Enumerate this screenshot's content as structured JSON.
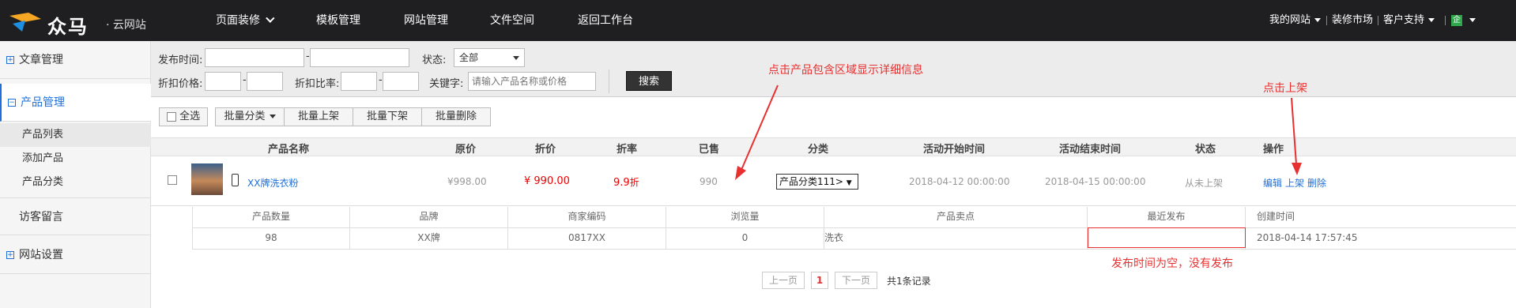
{
  "topbar": {
    "logo_text": "众马",
    "logo_sub": "· 云网站",
    "nav": [
      "页面装修",
      "模板管理",
      "网站管理",
      "文件空间",
      "返回工作台"
    ],
    "right": {
      "my_site": "我的网站",
      "market": "装修市场",
      "support": "客户支持",
      "tenant": "企"
    }
  },
  "sidebar": {
    "article": "文章管理",
    "product": "产品管理",
    "sub": [
      "产品列表",
      "添加产品",
      "产品分类"
    ],
    "visitor": "访客留言",
    "settings": "网站设置"
  },
  "filter": {
    "publish_time_label": "发布时间:",
    "status_label": "状态:",
    "status_value": "全部",
    "discount_price_label": "折扣价格:",
    "discount_rate_label": "折扣比率:",
    "keyword_label": "关键字:",
    "keyword_placeholder": "请输入产品名称或价格",
    "search": "搜索",
    "dash": "-"
  },
  "toolbar": {
    "select_all": "全选",
    "batch_category": "批量分类",
    "batch_up": "批量上架",
    "batch_down": "批量下架",
    "batch_delete": "批量删除"
  },
  "table": {
    "headers": [
      "产品名称",
      "原价",
      "折价",
      "折率",
      "已售",
      "分类",
      "活动开始时间",
      "活动结束时间",
      "状态",
      "操作"
    ],
    "row": {
      "name": "XX牌洗衣粉",
      "price": "¥998.00",
      "discount_price": "¥ 990.00",
      "rate_num": "9.9",
      "rate_unit": "折",
      "sold": "990",
      "category": "产品分类111>",
      "start": "2018-04-12 00:00:00",
      "end": "2018-04-15 00:00:00",
      "status": "从未上架",
      "actions": [
        "编辑",
        "上架",
        "删除"
      ]
    },
    "detail_headers": [
      "产品数量",
      "品牌",
      "商家编码",
      "浏览量",
      "产品卖点",
      "最近发布",
      "创建时间"
    ],
    "detail_values": [
      "98",
      "XX牌",
      "0817XX",
      "0",
      "洗衣",
      "",
      "2018-04-14 17:57:45"
    ]
  },
  "pager": {
    "prev": "上一页",
    "page": "1",
    "next": "下一页",
    "total": "共1条记录"
  },
  "annotations": {
    "click_product": "点击产品包含区域显示详细信息",
    "click_up": "点击上架",
    "publish_empty": "发布时间为空，没有发布"
  },
  "colors": {
    "topbar": "#1f1f22",
    "accent": "#1e6fd9",
    "annotation": "#e83030"
  }
}
